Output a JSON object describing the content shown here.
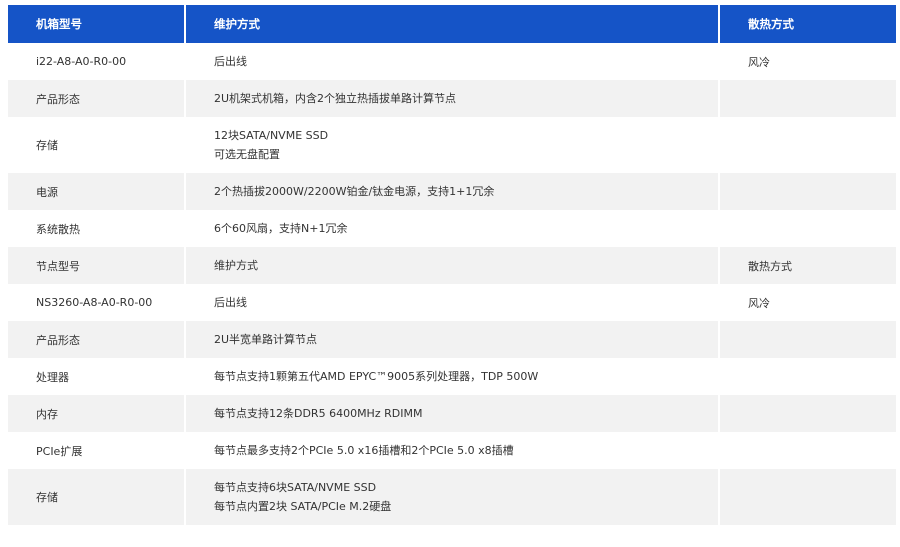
{
  "header": {
    "col1": "机箱型号",
    "col2": "维护方式",
    "col3": "散热方式"
  },
  "rows": [
    {
      "label": "i22-A8-A0-R0-00",
      "value": [
        "后出线"
      ],
      "extra": "风冷"
    },
    {
      "label": "产品形态",
      "value": [
        "2U机架式机箱，内含2个独立热插拔单路计算节点"
      ],
      "extra": ""
    },
    {
      "label": "存储",
      "value": [
        "12块SATA/NVME SSD",
        "可选无盘配置"
      ],
      "extra": ""
    },
    {
      "label": "电源",
      "value": [
        "2个热插拔2000W/2200W铂金/钛金电源，支持1+1冗余"
      ],
      "extra": ""
    },
    {
      "label": "系统散热",
      "value": [
        "6个60风扇，支持N+1冗余"
      ],
      "extra": ""
    },
    {
      "label": "节点型号",
      "value": [
        "维护方式"
      ],
      "extra": "散热方式"
    },
    {
      "label": "NS3260-A8-A0-R0-00",
      "value": [
        "后出线"
      ],
      "extra": "风冷"
    },
    {
      "label": "产品形态",
      "value": [
        "2U半宽单路计算节点"
      ],
      "extra": ""
    },
    {
      "label": "处理器",
      "value": [
        "每节点支持1颗第五代AMD EPYC™9005系列处理器，TDP 500W"
      ],
      "extra": ""
    },
    {
      "label": "内存",
      "value": [
        "每节点支持12条DDR5 6400MHz RDIMM"
      ],
      "extra": ""
    },
    {
      "label": "PCIe扩展",
      "value": [
        "每节点最多支持2个PCIe 5.0 x16插槽和2个PCIe 5.0 x8插槽"
      ],
      "extra": ""
    },
    {
      "label": "存储",
      "value": [
        "每节点支持6块SATA/NVME SSD",
        "每节点内置2块 SATA/PCIe M.2硬盘"
      ],
      "extra": ""
    }
  ]
}
